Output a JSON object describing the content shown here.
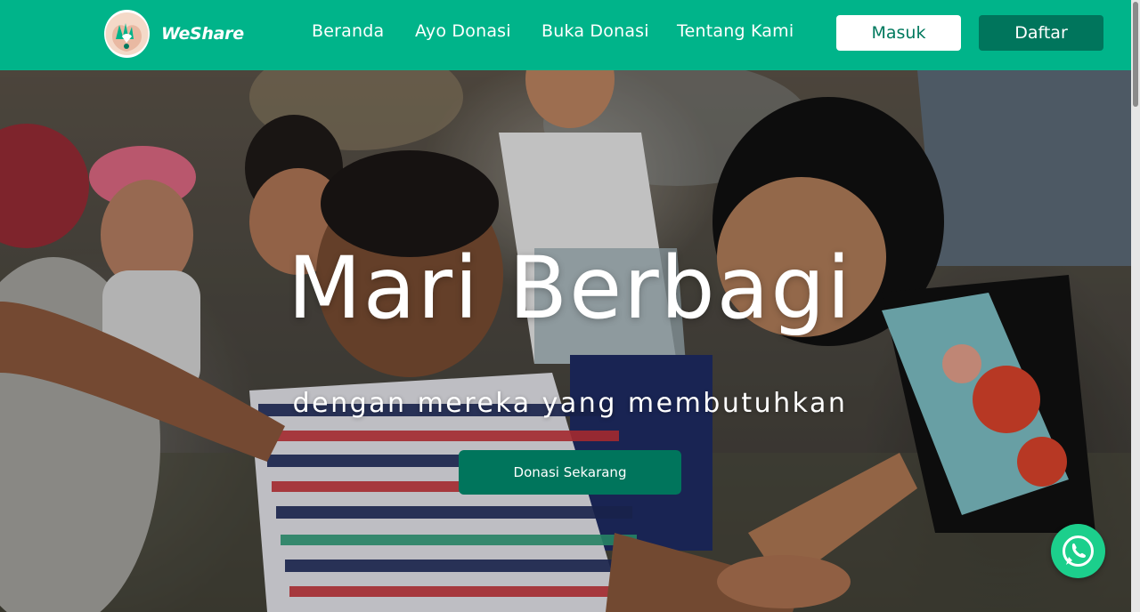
{
  "brand": {
    "name": "WeShare",
    "logo": "hands-heart-logo"
  },
  "nav": {
    "links": [
      "Beranda",
      "Ayo Donasi",
      "Buka Donasi",
      "Tentang Kami"
    ],
    "login_label": "Masuk",
    "register_label": "Daftar"
  },
  "hero": {
    "title": "Mari Berbagi",
    "subtitle": "dengan mereka yang membutuhkan",
    "cta_label": "Donasi Sekarang",
    "image": "children-playing-holding-hands-photo"
  },
  "floating": {
    "whatsapp_icon": "whatsapp-icon"
  },
  "colors": {
    "primary": "#00b48a",
    "primary_dark": "#00755c",
    "white": "#ffffff",
    "whatsapp": "#1ccf8c"
  }
}
